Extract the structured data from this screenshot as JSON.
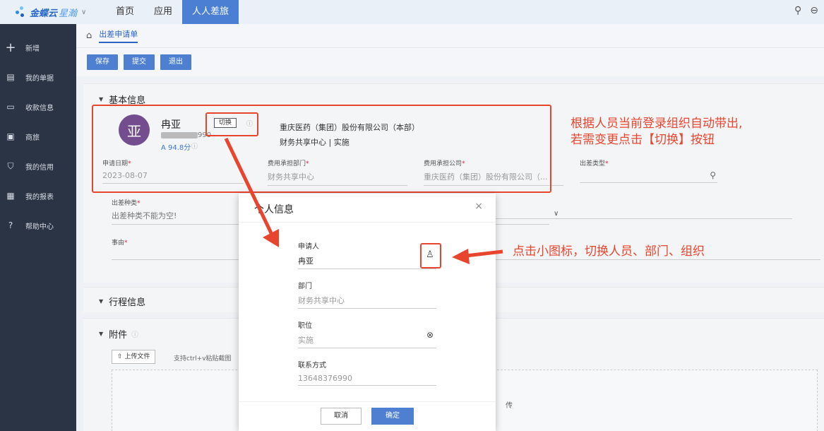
{
  "topbar": {
    "logo": "金蝶云",
    "logo_sub": "星瀚",
    "nav": [
      "首页",
      "应用",
      "人人差旅"
    ]
  },
  "sidebar": {
    "items": [
      {
        "label": "新增",
        "icon": "plus-icon"
      },
      {
        "label": "我的单据",
        "icon": "document-icon"
      },
      {
        "label": "收款信息",
        "icon": "card-icon"
      },
      {
        "label": "商旅",
        "icon": "briefcase-icon"
      },
      {
        "label": "我的信用",
        "icon": "shield-icon"
      },
      {
        "label": "我的报表",
        "icon": "chart-icon"
      },
      {
        "label": "帮助中心",
        "icon": "help-icon"
      }
    ]
  },
  "breadcrumb": {
    "title": "出差申请单"
  },
  "toolbar": {
    "save": "保存",
    "submit": "提交",
    "exit": "退出"
  },
  "basic": {
    "title": "基本信息",
    "avatar_char": "亚",
    "name": "冉亚",
    "phone_masked": "990",
    "score": "A 94.8分",
    "switch_label": "切换",
    "company": "重庆医药（集团）股份有限公司（本部）",
    "dept_role": "财务共享中心 | 实施",
    "apply_date_label": "申请日期",
    "apply_date": "2023-08-07",
    "cost_dept_label": "费用承担部门",
    "cost_dept": "财务共享中心",
    "cost_company_label": "费用承担公司",
    "cost_company": "重庆医药（集团）股份有限公司（...",
    "trip_type_label": "出差类型",
    "trip_kind_label": "出差种类",
    "trip_kind_placeholder": "出差种类不能为空!",
    "reason_label": "事由"
  },
  "itinerary": {
    "title": "行程信息"
  },
  "attachment": {
    "title": "附件",
    "upload": "上传文件",
    "hint": "支持ctrl+v粘贴截图",
    "drop_tail": "传"
  },
  "dialog": {
    "title": "个人信息",
    "applicant_label": "申请人",
    "applicant": "冉亚",
    "dept_label": "部门",
    "dept": "财务共享中心",
    "position_label": "职位",
    "position": "实施",
    "contact_label": "联系方式",
    "contact": "13648376990",
    "cancel": "取消",
    "confirm": "确定"
  },
  "annotations": {
    "note1_line1": "根据人员当前登录组织自动带出,",
    "note1_line2": "若需变更点击【切换】按钮",
    "note2": "点击小图标，切换人员、部门、组织"
  },
  "colors": {
    "accent": "#4e7fd1",
    "annotation": "#e8452e",
    "sidebar": "#2b3445"
  }
}
